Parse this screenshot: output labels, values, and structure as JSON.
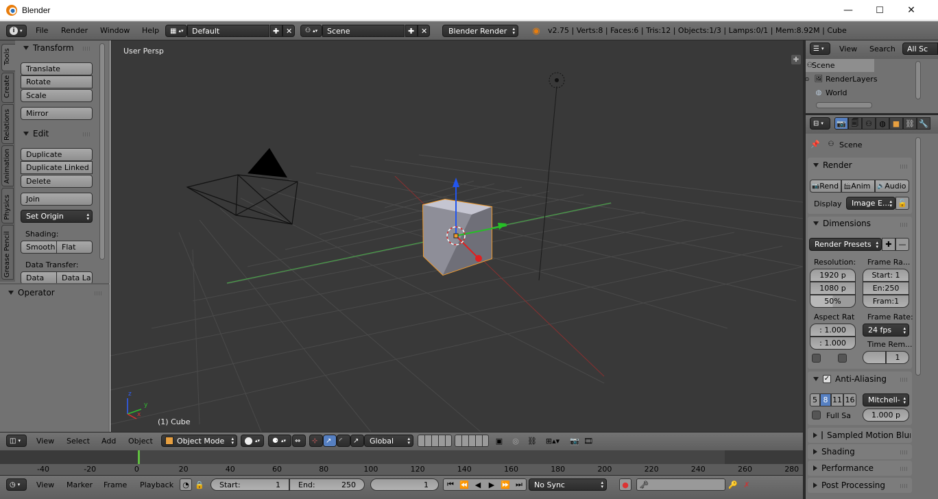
{
  "window": {
    "title": "Blender",
    "minimize": "—",
    "maximize": "☐",
    "close": "✕"
  },
  "info_header": {
    "menus": [
      "File",
      "Render",
      "Window",
      "Help"
    ],
    "layout": "Default",
    "scene": "Scene",
    "engine": "Blender Render",
    "stats": "v2.75 | Verts:8 | Faces:6 | Tris:12 | Objects:1/3 | Lamps:0/1 | Mem:8.92M | Cube"
  },
  "toolshelf": {
    "tabs": [
      "Tools",
      "Create",
      "Relations",
      "Animation",
      "Physics",
      "Grease Pencil"
    ],
    "transform_title": "Transform",
    "translate": "Translate",
    "rotate": "Rotate",
    "scale": "Scale",
    "mirror": "Mirror",
    "edit_title": "Edit",
    "duplicate": "Duplicate",
    "duplicate_linked": "Duplicate Linked",
    "delete": "Delete",
    "join": "Join",
    "set_origin": "Set Origin",
    "shading_label": "Shading:",
    "smooth": "Smooth",
    "flat": "Flat",
    "data_transfer_label": "Data Transfer:",
    "data": "Data",
    "data_la": "Data La",
    "operator_title": "Operator"
  },
  "viewport": {
    "view_label": "User Persp",
    "object_label": "(1) Cube",
    "axis_x": "x",
    "axis_y": "y",
    "axis_z": "z"
  },
  "view3d_header": {
    "menus": [
      "View",
      "Select",
      "Add",
      "Object"
    ],
    "mode": "Object Mode",
    "orientation": "Global"
  },
  "timeline": {
    "ruler": [
      "-40",
      "-20",
      "0",
      "20",
      "40",
      "60",
      "80",
      "100",
      "120",
      "140",
      "160",
      "180",
      "200",
      "220",
      "240",
      "260",
      "280"
    ],
    "menus": [
      "View",
      "Marker",
      "Frame",
      "Playback"
    ],
    "start": "Start:",
    "start_val": "1",
    "end": "End:",
    "end_val": "250",
    "current": "1",
    "sync": "No Sync"
  },
  "outliner": {
    "view": "View",
    "search": "Search",
    "filter": "All Sc",
    "items": [
      "Scene",
      "RenderLayers",
      "World"
    ]
  },
  "properties": {
    "context": "Scene",
    "render_title": "Render",
    "rend": "Rend",
    "anim": "Anim",
    "audio": "Audio",
    "display_label": "Display",
    "display_val": "Image E...",
    "dimensions_title": "Dimensions",
    "render_presets": "Render Presets",
    "resolution_label": "Resolution:",
    "res_x": "1920 p",
    "res_y": "1080 p",
    "res_pct": "50%",
    "frame_range_label": "Frame Ra...",
    "fr_start": "Start: 1",
    "fr_end": "En:250",
    "fr_step": "Fram:1",
    "aspect_label": "Aspect Rat",
    "asp_x": ": 1.000",
    "asp_y": ": 1.000",
    "frame_rate_label": "Frame Rate:",
    "fps": "24 fps",
    "time_rem_label": "Time Rem...",
    "time_rem_val": "1",
    "aa_title": "Anti-Aliasing",
    "aa_samples": [
      "5",
      "8",
      "11",
      "16"
    ],
    "aa_filter": "Mitchell-",
    "full_sample": "Full Sa",
    "filter_size": "1.000 p",
    "smb_title": "Sampled Motion Blur",
    "shading_title": "Shading",
    "performance_title": "Performance",
    "post_title": "Post Processing"
  }
}
